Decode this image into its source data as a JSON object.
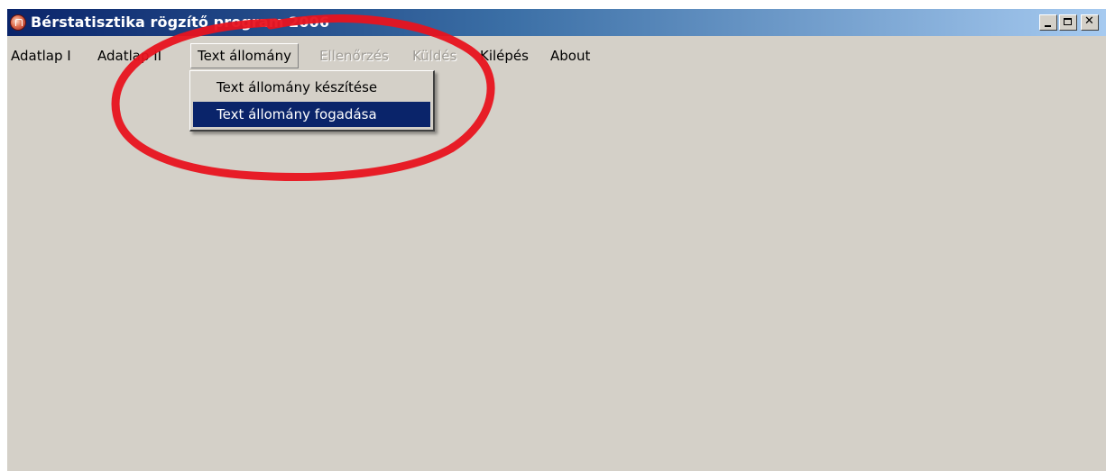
{
  "window": {
    "title": "Bérstatisztika rögzítő program 2006"
  },
  "menubar": {
    "items": [
      {
        "label": "Adatlap I",
        "enabled": true
      },
      {
        "label": "Adatlap II",
        "enabled": true
      },
      {
        "label": "Text állomány",
        "enabled": true,
        "open": true
      },
      {
        "label": "Ellenőrzés",
        "enabled": false
      },
      {
        "label": "Küldés",
        "enabled": false
      },
      {
        "label": "Kilépés",
        "enabled": true
      },
      {
        "label": "About",
        "enabled": true
      }
    ]
  },
  "dropdown": {
    "items": [
      {
        "label": "Text állomány készítése",
        "selected": false
      },
      {
        "label": "Text állomány fogadása",
        "selected": true
      }
    ]
  },
  "icons": {
    "app": "app-icon",
    "minimize": "minimize-icon",
    "maximize": "maximize-icon",
    "close": "close-icon"
  },
  "colors": {
    "titlebar_start": "#0a246a",
    "titlebar_end": "#a6caf0",
    "window_bg": "#d4d0c8",
    "selection": "#0a246a",
    "annotation": "#e8131f"
  }
}
